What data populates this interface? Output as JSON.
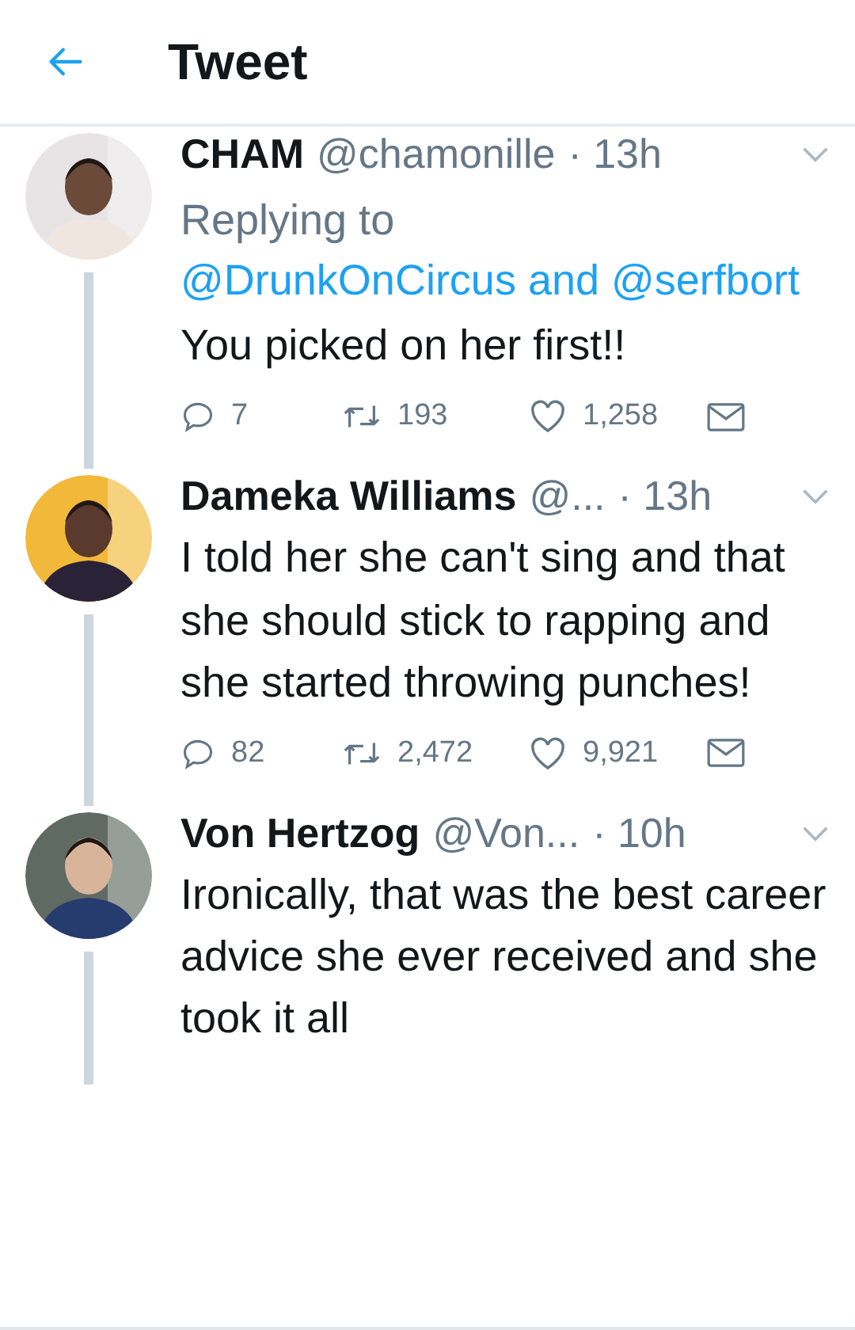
{
  "header": {
    "title": "Tweet"
  },
  "tweets": [
    {
      "name": "CHAM",
      "handle": "@chamonille",
      "time": "· 13h",
      "reply_to": {
        "label": "Replying to",
        "mentions": "@DrunkOnCircus and @serfbort"
      },
      "text": "You picked on her first!!",
      "stats": {
        "replies": "7",
        "retweets": "193",
        "likes": "1,258"
      }
    },
    {
      "name": "Dameka Williams",
      "handle": "@...",
      "time": "· 13h",
      "text": "I told her she can't sing and that she should stick to rapping and she started throwing punches!",
      "stats": {
        "replies": "82",
        "retweets": "2,472",
        "likes": "9,921"
      }
    },
    {
      "name": "Von Hertzog",
      "handle": "@Von...",
      "time": "· 10h",
      "text": "Ironically, that was the best career advice she ever received and she took it all"
    }
  ]
}
